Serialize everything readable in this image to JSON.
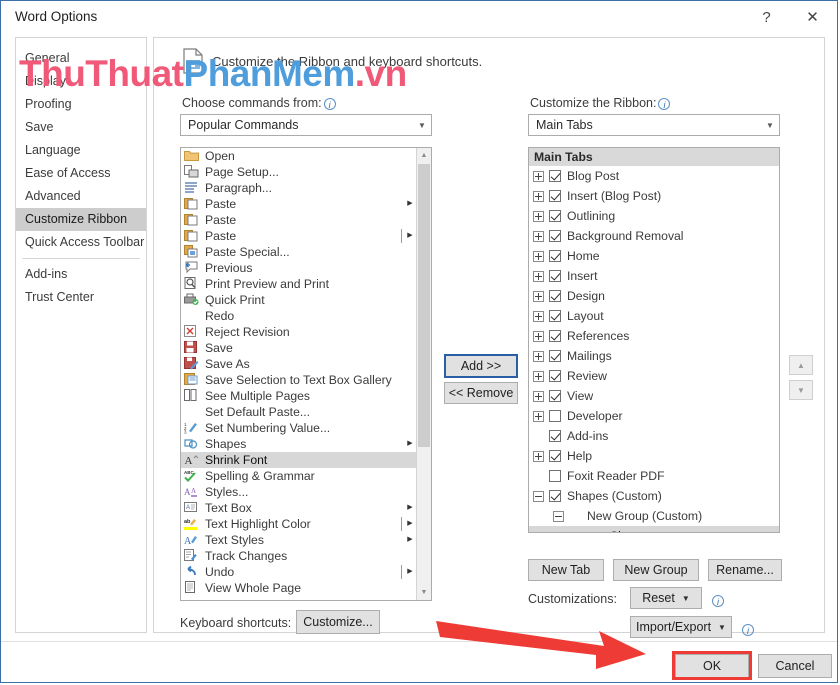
{
  "window": {
    "title": "Word Options",
    "help_icon": "?",
    "close_icon": "✕"
  },
  "watermark": {
    "part1": "ThuThuat",
    "part2": "PhanMem",
    "part3": ".vn",
    "color1": "#f05a78",
    "color2": "#4f9ddb"
  },
  "sidebar": {
    "items": [
      {
        "label": "General",
        "selected": false
      },
      {
        "label": "Display",
        "selected": false
      },
      {
        "label": "Proofing",
        "selected": false
      },
      {
        "label": "Save",
        "selected": false
      },
      {
        "label": "Language",
        "selected": false
      },
      {
        "label": "Ease of Access",
        "selected": false
      },
      {
        "label": "Advanced",
        "selected": false
      },
      {
        "label": "Customize Ribbon",
        "selected": true
      },
      {
        "label": "Quick Access Toolbar",
        "selected": false
      },
      {
        "label": "Add-ins",
        "selected": false
      },
      {
        "label": "Trust Center",
        "selected": false
      }
    ]
  },
  "main": {
    "header": "Customize the Ribbon and keyboard shortcuts.",
    "choose_commands_label": "Choose commands from:",
    "choose_commands_value": "Popular Commands",
    "customize_ribbon_label": "Customize the Ribbon:",
    "customize_ribbon_value": "Main Tabs",
    "keyboard_shortcuts_label": "Keyboard shortcuts:",
    "customize_button": "Customize...",
    "customizations_label": "Customizations:"
  },
  "commands": {
    "items": [
      {
        "label": "Open",
        "icon": "folder-icon",
        "submenu": false
      },
      {
        "label": "Page Setup...",
        "icon": "page-setup-icon",
        "submenu": false
      },
      {
        "label": "Paragraph...",
        "icon": "paragraph-icon",
        "submenu": false
      },
      {
        "label": "Paste",
        "icon": "paste-icon",
        "submenu": true
      },
      {
        "label": "Paste",
        "icon": "paste-icon",
        "submenu": false
      },
      {
        "label": "Paste",
        "icon": "paste-icon",
        "submenu": true,
        "split": true
      },
      {
        "label": "Paste Special...",
        "icon": "paste-special-icon",
        "submenu": false
      },
      {
        "label": "Previous",
        "icon": "previous-comment-icon",
        "submenu": false
      },
      {
        "label": "Print Preview and Print",
        "icon": "print-preview-icon",
        "submenu": false
      },
      {
        "label": "Quick Print",
        "icon": "quick-print-icon",
        "submenu": false
      },
      {
        "label": "Redo",
        "icon": "none",
        "submenu": false
      },
      {
        "label": "Reject Revision",
        "icon": "reject-revision-icon",
        "submenu": false
      },
      {
        "label": "Save",
        "icon": "save-icon",
        "submenu": false
      },
      {
        "label": "Save As",
        "icon": "save-as-icon",
        "submenu": false
      },
      {
        "label": "Save Selection to Text Box Gallery",
        "icon": "save-selection-icon",
        "submenu": false
      },
      {
        "label": "See Multiple Pages",
        "icon": "multiple-pages-icon",
        "submenu": false
      },
      {
        "label": "Set Default Paste...",
        "icon": "none",
        "submenu": false
      },
      {
        "label": "Set Numbering Value...",
        "icon": "numbering-icon",
        "submenu": false
      },
      {
        "label": "Shapes",
        "icon": "shapes-icon",
        "submenu": true
      },
      {
        "label": "Shrink Font",
        "icon": "shrink-font-icon",
        "submenu": false,
        "selected": true
      },
      {
        "label": "Spelling & Grammar",
        "icon": "spelling-icon",
        "submenu": false
      },
      {
        "label": "Styles...",
        "icon": "styles-icon",
        "submenu": false
      },
      {
        "label": "Text Box",
        "icon": "text-box-icon",
        "submenu": true
      },
      {
        "label": "Text Highlight Color",
        "icon": "highlight-color-icon",
        "submenu": true,
        "split": true
      },
      {
        "label": "Text Styles",
        "icon": "text-styles-icon",
        "submenu": true
      },
      {
        "label": "Track Changes",
        "icon": "track-changes-icon",
        "submenu": false
      },
      {
        "label": "Undo",
        "icon": "undo-icon",
        "submenu": true,
        "split": true
      },
      {
        "label": "View Whole Page",
        "icon": "view-whole-page-icon",
        "submenu": false
      }
    ]
  },
  "ribbon_tree": {
    "header": "Main Tabs",
    "items": [
      {
        "label": "Blog Post",
        "expander": "plus",
        "checked": true,
        "indent": 0
      },
      {
        "label": "Insert (Blog Post)",
        "expander": "plus",
        "checked": true,
        "indent": 0
      },
      {
        "label": "Outlining",
        "expander": "plus",
        "checked": true,
        "indent": 0
      },
      {
        "label": "Background Removal",
        "expander": "plus",
        "checked": true,
        "indent": 0
      },
      {
        "label": "Home",
        "expander": "plus",
        "checked": true,
        "indent": 0
      },
      {
        "label": "Insert",
        "expander": "plus",
        "checked": true,
        "indent": 0
      },
      {
        "label": "Design",
        "expander": "plus",
        "checked": true,
        "indent": 0
      },
      {
        "label": "Layout",
        "expander": "plus",
        "checked": true,
        "indent": 0
      },
      {
        "label": "References",
        "expander": "plus",
        "checked": true,
        "indent": 0
      },
      {
        "label": "Mailings",
        "expander": "plus",
        "checked": true,
        "indent": 0
      },
      {
        "label": "Review",
        "expander": "plus",
        "checked": true,
        "indent": 0
      },
      {
        "label": "View",
        "expander": "plus",
        "checked": true,
        "indent": 0
      },
      {
        "label": "Developer",
        "expander": "plus",
        "checked": false,
        "indent": 0
      },
      {
        "label": "Add-ins",
        "expander": "none",
        "checked": true,
        "indent": 0
      },
      {
        "label": "Help",
        "expander": "plus",
        "checked": true,
        "indent": 0
      },
      {
        "label": "Foxit Reader PDF",
        "expander": "none",
        "checked": false,
        "indent": 0
      },
      {
        "label": "Shapes (Custom)",
        "expander": "minus",
        "checked": true,
        "indent": 0
      },
      {
        "label": "New Group (Custom)",
        "expander": "minus",
        "checked": null,
        "indent": 1
      },
      {
        "label": "Shapes",
        "expander": "none",
        "checked": null,
        "indent": 2,
        "icon": "shapes-icon",
        "selected": true,
        "submenu": true
      }
    ]
  },
  "buttons": {
    "add": "Add >>",
    "remove": "<< Remove",
    "new_tab": "New Tab",
    "new_group": "New Group",
    "rename": "Rename...",
    "reset": "Reset",
    "import_export": "Import/Export",
    "ok": "OK",
    "cancel": "Cancel",
    "move_up_icon": "▲",
    "move_down_icon": "▼"
  },
  "colors": {
    "accent_border": "#3d6ea5",
    "selection": "#d7d7d7",
    "header_band": "#d9d9d9",
    "annotation_red": "#ef3b36",
    "focus_blue": "#2a5fa5"
  }
}
